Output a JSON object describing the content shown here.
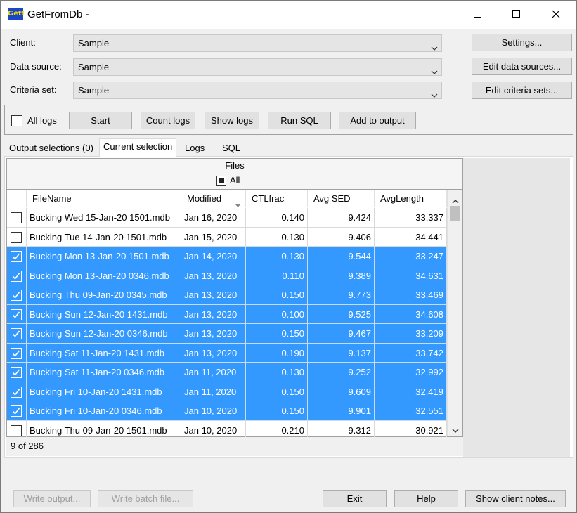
{
  "window": {
    "title": "GetFromDb -",
    "icon_label": "Get!",
    "controls": [
      "minimize-icon",
      "maximize-icon",
      "close-icon"
    ]
  },
  "form": {
    "client_label": "Client:",
    "client_value": "Sample",
    "datasource_label": "Data source:",
    "datasource_value": "Sample",
    "criteria_label": "Criteria set:",
    "criteria_value": "Sample",
    "settings_btn": "Settings...",
    "edit_datasources_btn": "Edit data sources...",
    "edit_criteria_btn": "Edit criteria sets..."
  },
  "toolbar": {
    "all_logs_label": "All logs",
    "all_logs_checked": false,
    "start": "Start",
    "count_logs": "Count logs",
    "show_logs": "Show logs",
    "run_sql": "Run SQL",
    "add_to_output": "Add to output"
  },
  "tabs": [
    {
      "label": "Output selections (0)",
      "active": false
    },
    {
      "label": "Current selection",
      "active": true
    },
    {
      "label": "Logs",
      "active": false
    },
    {
      "label": "SQL",
      "active": false
    }
  ],
  "grid": {
    "group_title": "Files",
    "all_label": "All",
    "columns": [
      "FileName",
      "Modified",
      "CTLfrac",
      "Avg SED",
      "AvgLength"
    ],
    "rows": [
      {
        "checked": false,
        "selected": false,
        "file": "Bucking Wed 15-Jan-20 1501.mdb",
        "modified": "Jan 16, 2020",
        "ctl": "0.140",
        "sed": "9.424",
        "len": "33.337"
      },
      {
        "checked": false,
        "selected": false,
        "file": "Bucking Tue 14-Jan-20 1501.mdb",
        "modified": "Jan 15, 2020",
        "ctl": "0.130",
        "sed": "9.406",
        "len": "34.441"
      },
      {
        "checked": true,
        "selected": true,
        "file": "Bucking Mon 13-Jan-20 1501.mdb",
        "modified": "Jan 14, 2020",
        "ctl": "0.130",
        "sed": "9.544",
        "len": "33.247"
      },
      {
        "checked": true,
        "selected": true,
        "file": "Bucking Mon 13-Jan-20 0346.mdb",
        "modified": "Jan 13, 2020",
        "ctl": "0.110",
        "sed": "9.389",
        "len": "34.631"
      },
      {
        "checked": true,
        "selected": true,
        "file": "Bucking Thu 09-Jan-20 0345.mdb",
        "modified": "Jan 13, 2020",
        "ctl": "0.150",
        "sed": "9.773",
        "len": "33.469"
      },
      {
        "checked": true,
        "selected": true,
        "file": "Bucking Sun 12-Jan-20 1431.mdb",
        "modified": "Jan 13, 2020",
        "ctl": "0.100",
        "sed": "9.525",
        "len": "34.608"
      },
      {
        "checked": true,
        "selected": true,
        "file": "Bucking Sun 12-Jan-20 0346.mdb",
        "modified": "Jan 13, 2020",
        "ctl": "0.150",
        "sed": "9.467",
        "len": "33.209"
      },
      {
        "checked": true,
        "selected": true,
        "file": "Bucking Sat 11-Jan-20 1431.mdb",
        "modified": "Jan 13, 2020",
        "ctl": "0.190",
        "sed": "9.137",
        "len": "33.742"
      },
      {
        "checked": true,
        "selected": true,
        "file": "Bucking Sat 11-Jan-20 0346.mdb",
        "modified": "Jan 11, 2020",
        "ctl": "0.130",
        "sed": "9.252",
        "len": "32.992"
      },
      {
        "checked": true,
        "selected": true,
        "file": "Bucking Fri 10-Jan-20 1431.mdb",
        "modified": "Jan 11, 2020",
        "ctl": "0.150",
        "sed": "9.609",
        "len": "32.419"
      },
      {
        "checked": true,
        "selected": true,
        "file": "Bucking Fri 10-Jan-20 0346.mdb",
        "modified": "Jan 10, 2020",
        "ctl": "0.150",
        "sed": "9.901",
        "len": "32.551"
      },
      {
        "checked": false,
        "selected": false,
        "file": "Bucking Thu 09-Jan-20 1501.mdb",
        "modified": "Jan 10, 2020",
        "ctl": "0.210",
        "sed": "9.312",
        "len": "30.921"
      }
    ],
    "status": "9 of 286"
  },
  "footer": {
    "write_output": "Write output...",
    "write_batch": "Write batch file...",
    "exit": "Exit",
    "help": "Help",
    "show_client_notes": "Show client notes..."
  },
  "colors": {
    "selection": "#3399ff",
    "titlebar": "#ffffff",
    "window": "#f0f0f0"
  }
}
